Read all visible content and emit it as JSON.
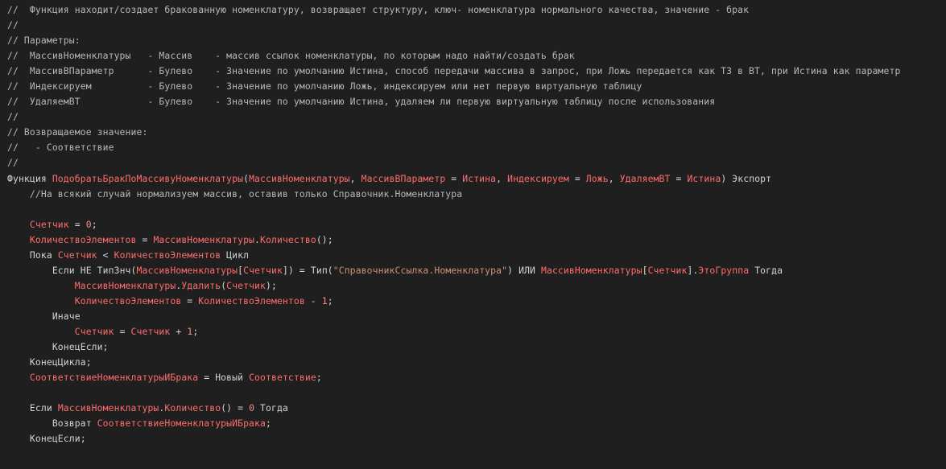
{
  "colors": {
    "background": "#1f1f1f",
    "comment": "#b8b8b8",
    "keyword": "#d4d4d4",
    "identifier": "#ff6d6d",
    "plain": "#d4d4d4",
    "string": "#ce9178",
    "number": "#f08c8c"
  },
  "lines": [
    [
      {
        "t": "comment",
        "v": "//  Функция находит/создает бракованную номенклатуру, возвращает структуру, ключ- номенклатура нормального качества, значение - брак"
      }
    ],
    [
      {
        "t": "comment",
        "v": "//"
      }
    ],
    [
      {
        "t": "comment",
        "v": "// Параметры:"
      }
    ],
    [
      {
        "t": "comment",
        "v": "//  МассивНоменклатуры   - Массив    - массив ссылок номенклатуры, по которым надо найти/создать брак"
      }
    ],
    [
      {
        "t": "comment",
        "v": "//  МассивВПараметр      - Булево    - Значение по умолчанию Истина, способ передачи массива в запрос, при Ложь передается как ТЗ в ВТ, при Истина как параметр"
      }
    ],
    [
      {
        "t": "comment",
        "v": "//  Индексируем          - Булево    - Значение по умолчанию Ложь, индексируем или нет первую виртуальную таблицу"
      }
    ],
    [
      {
        "t": "comment",
        "v": "//  УдаляемВТ            - Булево    - Значение по умолчанию Истина, удаляем ли первую виртуальную таблицу после использования"
      }
    ],
    [
      {
        "t": "comment",
        "v": "//"
      }
    ],
    [
      {
        "t": "comment",
        "v": "// Возвращаемое значение:"
      }
    ],
    [
      {
        "t": "comment",
        "v": "//   - Соответствие"
      }
    ],
    [
      {
        "t": "comment",
        "v": "//"
      }
    ],
    [
      {
        "t": "keyword",
        "v": "Функция "
      },
      {
        "t": "ident",
        "v": "ПодобратьБракПоМассивуНоменклатуры"
      },
      {
        "t": "plain",
        "v": "("
      },
      {
        "t": "ident",
        "v": "МассивНоменклатуры"
      },
      {
        "t": "plain",
        "v": ", "
      },
      {
        "t": "ident",
        "v": "МассивВПараметр"
      },
      {
        "t": "plain",
        "v": " = "
      },
      {
        "t": "ident",
        "v": "Истина"
      },
      {
        "t": "plain",
        "v": ", "
      },
      {
        "t": "ident",
        "v": "Индексируем"
      },
      {
        "t": "plain",
        "v": " = "
      },
      {
        "t": "ident",
        "v": "Ложь"
      },
      {
        "t": "plain",
        "v": ", "
      },
      {
        "t": "ident",
        "v": "УдаляемВТ"
      },
      {
        "t": "plain",
        "v": " = "
      },
      {
        "t": "ident",
        "v": "Истина"
      },
      {
        "t": "plain",
        "v": ") "
      },
      {
        "t": "keyword",
        "v": "Экспорт"
      }
    ],
    [
      {
        "t": "comment",
        "v": "    //На всякий случай нормализуем массив, оставив только Справочник.Номенклатура"
      }
    ],
    [],
    [
      {
        "t": "plain",
        "v": "    "
      },
      {
        "t": "ident",
        "v": "Счетчик"
      },
      {
        "t": "plain",
        "v": " = "
      },
      {
        "t": "number",
        "v": "0"
      },
      {
        "t": "plain",
        "v": ";"
      }
    ],
    [
      {
        "t": "plain",
        "v": "    "
      },
      {
        "t": "ident",
        "v": "КоличествоЭлементов"
      },
      {
        "t": "plain",
        "v": " = "
      },
      {
        "t": "ident",
        "v": "МассивНоменклатуры"
      },
      {
        "t": "plain",
        "v": "."
      },
      {
        "t": "ident",
        "v": "Количество"
      },
      {
        "t": "plain",
        "v": "();"
      }
    ],
    [
      {
        "t": "plain",
        "v": "    "
      },
      {
        "t": "keyword",
        "v": "Пока "
      },
      {
        "t": "ident",
        "v": "Счетчик"
      },
      {
        "t": "plain",
        "v": " < "
      },
      {
        "t": "ident",
        "v": "КоличествоЭлементов"
      },
      {
        "t": "keyword",
        "v": " Цикл"
      }
    ],
    [
      {
        "t": "plain",
        "v": "        "
      },
      {
        "t": "keyword",
        "v": "Если НЕ "
      },
      {
        "t": "plain",
        "v": "ТипЗнч("
      },
      {
        "t": "ident",
        "v": "МассивНоменклатуры"
      },
      {
        "t": "plain",
        "v": "["
      },
      {
        "t": "ident",
        "v": "Счетчик"
      },
      {
        "t": "plain",
        "v": "]) = "
      },
      {
        "t": "plain",
        "v": "Тип("
      },
      {
        "t": "string",
        "v": "\"СправочникСсылка.Номенклатура\""
      },
      {
        "t": "plain",
        "v": ") "
      },
      {
        "t": "keyword",
        "v": "ИЛИ "
      },
      {
        "t": "ident",
        "v": "МассивНоменклатуры"
      },
      {
        "t": "plain",
        "v": "["
      },
      {
        "t": "ident",
        "v": "Счетчик"
      },
      {
        "t": "plain",
        "v": "]."
      },
      {
        "t": "ident",
        "v": "ЭтоГруппа"
      },
      {
        "t": "keyword",
        "v": " Тогда"
      }
    ],
    [
      {
        "t": "plain",
        "v": "            "
      },
      {
        "t": "ident",
        "v": "МассивНоменклатуры"
      },
      {
        "t": "plain",
        "v": "."
      },
      {
        "t": "ident",
        "v": "Удалить"
      },
      {
        "t": "plain",
        "v": "("
      },
      {
        "t": "ident",
        "v": "Счетчик"
      },
      {
        "t": "plain",
        "v": ");"
      }
    ],
    [
      {
        "t": "plain",
        "v": "            "
      },
      {
        "t": "ident",
        "v": "КоличествоЭлементов"
      },
      {
        "t": "plain",
        "v": " = "
      },
      {
        "t": "ident",
        "v": "КоличествоЭлементов"
      },
      {
        "t": "plain",
        "v": " - "
      },
      {
        "t": "number",
        "v": "1"
      },
      {
        "t": "plain",
        "v": ";"
      }
    ],
    [
      {
        "t": "plain",
        "v": "        "
      },
      {
        "t": "keyword",
        "v": "Иначе"
      }
    ],
    [
      {
        "t": "plain",
        "v": "            "
      },
      {
        "t": "ident",
        "v": "Счетчик"
      },
      {
        "t": "plain",
        "v": " = "
      },
      {
        "t": "ident",
        "v": "Счетчик"
      },
      {
        "t": "plain",
        "v": " + "
      },
      {
        "t": "number",
        "v": "1"
      },
      {
        "t": "plain",
        "v": ";"
      }
    ],
    [
      {
        "t": "plain",
        "v": "        "
      },
      {
        "t": "keyword",
        "v": "КонецЕсли"
      },
      {
        "t": "plain",
        "v": ";"
      }
    ],
    [
      {
        "t": "plain",
        "v": "    "
      },
      {
        "t": "keyword",
        "v": "КонецЦикла"
      },
      {
        "t": "plain",
        "v": ";"
      }
    ],
    [
      {
        "t": "plain",
        "v": "    "
      },
      {
        "t": "ident",
        "v": "СоответствиеНоменклатурыИБрака"
      },
      {
        "t": "plain",
        "v": " = "
      },
      {
        "t": "keyword",
        "v": "Новый "
      },
      {
        "t": "ident",
        "v": "Соответствие"
      },
      {
        "t": "plain",
        "v": ";"
      }
    ],
    [],
    [
      {
        "t": "plain",
        "v": "    "
      },
      {
        "t": "keyword",
        "v": "Если "
      },
      {
        "t": "ident",
        "v": "МассивНоменклатуры"
      },
      {
        "t": "plain",
        "v": "."
      },
      {
        "t": "ident",
        "v": "Количество"
      },
      {
        "t": "plain",
        "v": "() = "
      },
      {
        "t": "number",
        "v": "0"
      },
      {
        "t": "keyword",
        "v": " Тогда"
      }
    ],
    [
      {
        "t": "plain",
        "v": "        "
      },
      {
        "t": "keyword",
        "v": "Возврат "
      },
      {
        "t": "ident",
        "v": "СоответствиеНоменклатурыИБрака"
      },
      {
        "t": "plain",
        "v": ";"
      }
    ],
    [
      {
        "t": "plain",
        "v": "    "
      },
      {
        "t": "keyword",
        "v": "КонецЕсли"
      },
      {
        "t": "plain",
        "v": ";"
      }
    ]
  ]
}
